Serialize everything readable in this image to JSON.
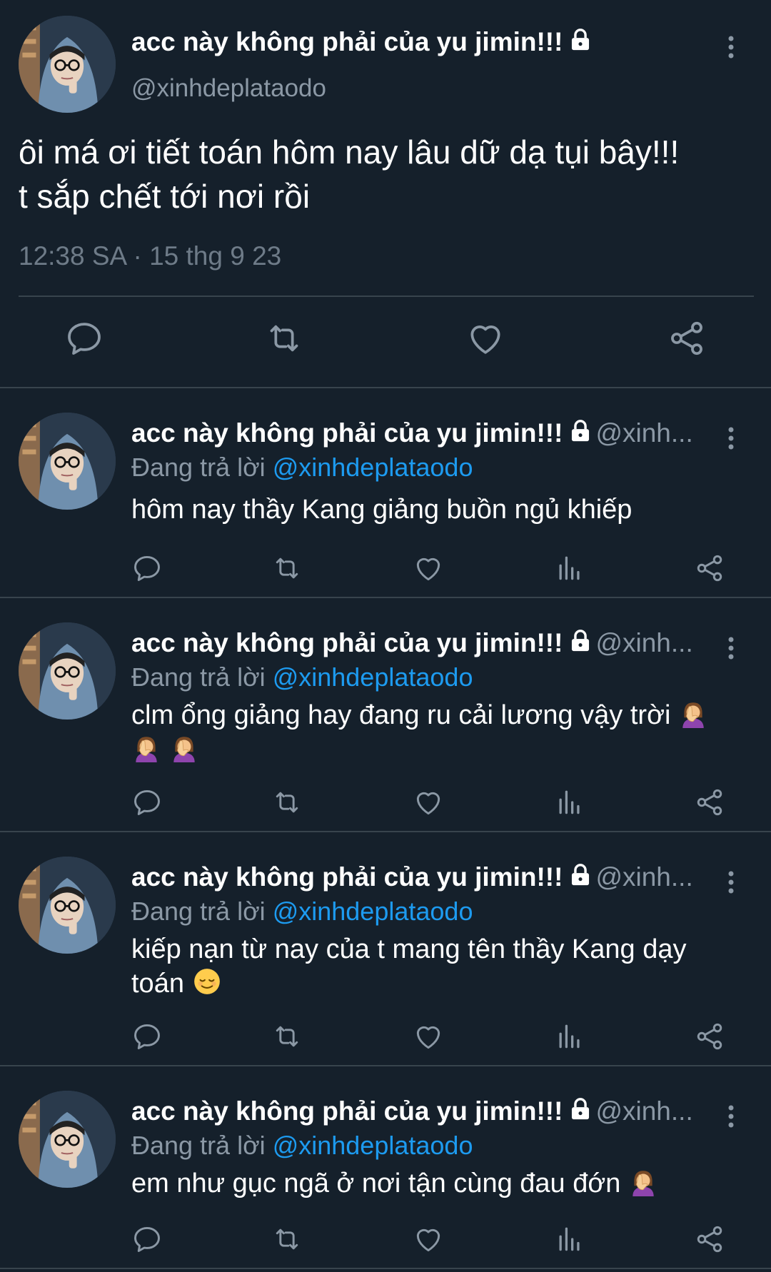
{
  "main_tweet": {
    "author_name": "acc này không phải của yu jimin!!!",
    "author_handle": "@xinhdeplataodo",
    "text_line1": "ôi má ơi tiết toán hôm nay lâu dữ dạ tụi bây!!!",
    "text_line2": "t sắp chết tới nơi rồi",
    "timestamp": "12:38 SA · 15 thg 9 23",
    "icons": [
      "reply-icon",
      "retweet-icon",
      "like-icon",
      "share-icon"
    ]
  },
  "replies": [
    {
      "author_name": "acc này không phải của yu jimin!!!",
      "author_handle": "@xinh...",
      "replying_prefix": "Đang trả lời",
      "replying_to": "@xinhdeplataodo",
      "text": "hôm nay thầy Kang giảng buồn ngủ khiếp"
    },
    {
      "author_name": "acc này không phải của yu jimin!!!",
      "author_handle": "@xinh...",
      "replying_prefix": "Đang trả lời",
      "replying_to": "@xinhdeplataodo",
      "text": "clm ổng giảng hay đang ru cải lương vậy trời",
      "emojis": [
        "face-palm-emoji",
        "face-palm-emoji",
        "face-palm-emoji"
      ]
    },
    {
      "author_name": "acc này không phải của yu jimin!!!",
      "author_handle": "@xinh...",
      "replying_prefix": "Đang trả lời",
      "replying_to": "@xinhdeplataodo",
      "text": "kiếp nạn từ nay của t mang tên thầy Kang dạy toán",
      "emojis": [
        "relieved-face-emoji"
      ]
    },
    {
      "author_name": "acc này không phải của yu jimin!!!",
      "author_handle": "@xinh...",
      "replying_prefix": "Đang trả lời",
      "replying_to": "@xinhdeplataodo",
      "text": "em như gục ngã ở nơi tận cùng đau đớn",
      "emojis": [
        "face-palm-emoji"
      ]
    }
  ],
  "colors": {
    "background": "#15202b",
    "divider": "#38444d",
    "secondary_text": "#8b98a5",
    "mention": "#1d9bf0",
    "icon": "#8b98a5"
  }
}
